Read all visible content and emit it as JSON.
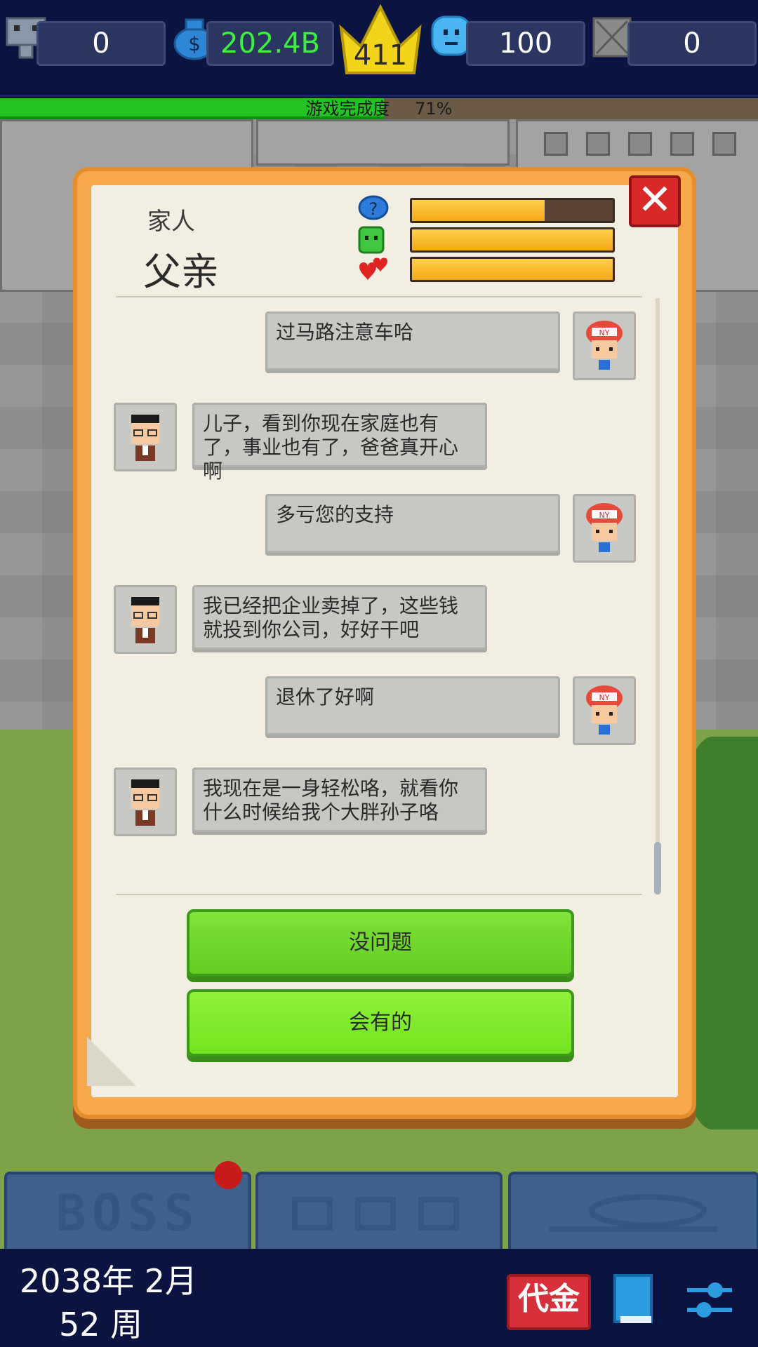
{
  "top_stats": {
    "employees": "0",
    "money": "202.4B",
    "rank": "411",
    "happiness": "100",
    "disabled_stat": "0"
  },
  "progress": {
    "label": "游戏完成度",
    "percent_text": "71%",
    "fraction": 0.71
  },
  "dialog": {
    "category": "家人",
    "name": "父亲",
    "meters": [
      {
        "icon": "question-bubble-icon",
        "fraction": 0.66
      },
      {
        "icon": "green-face-icon",
        "fraction": 1.0
      },
      {
        "icon": "hearts-icon",
        "fraction": 1.0
      }
    ],
    "messages": [
      {
        "side": "right",
        "text": "过马路注意车哈"
      },
      {
        "side": "left",
        "text": "儿子，看到你现在家庭也有了，事业也有了，爸爸真开心啊"
      },
      {
        "side": "right",
        "text": "多亏您的支持"
      },
      {
        "side": "left",
        "text": "我已经把企业卖掉了，这些钱就投到你公司，好好干吧"
      },
      {
        "side": "right",
        "text": "退休了好啊"
      },
      {
        "side": "left",
        "text": "我现在是一身轻松咯，就看你什么时候给我个大胖孙子咯"
      }
    ],
    "choices": [
      "没问题",
      "会有的"
    ],
    "close": "✕"
  },
  "bottom_tabs": {
    "boss": "BOSS",
    "staff": "",
    "pet": ""
  },
  "footer": {
    "date": "2038年 2月",
    "week": "52 周",
    "loan_button": "代金"
  },
  "colors": {
    "progress_green": "#22c322",
    "dialog_orange": "#f7a84a",
    "choice_green": "#72e320",
    "close_red": "#d82828"
  }
}
